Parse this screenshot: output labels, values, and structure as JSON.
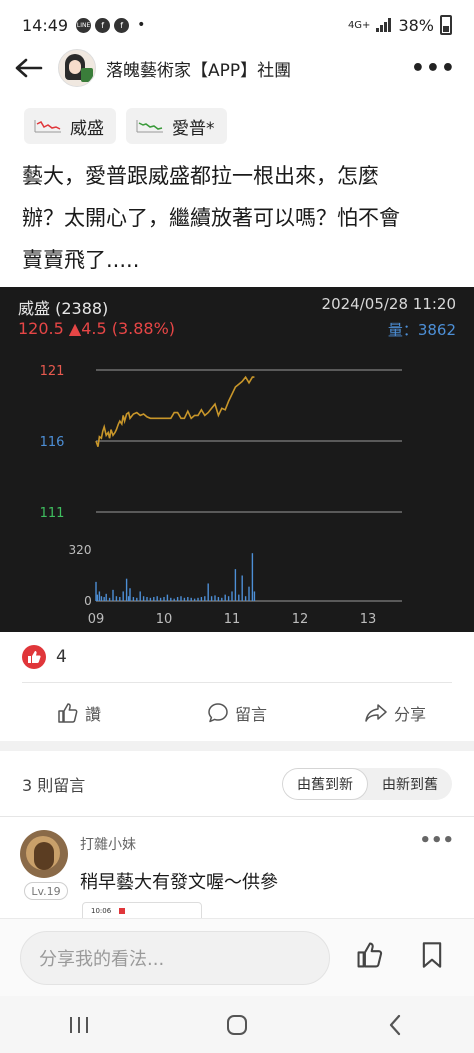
{
  "status_bar": {
    "time": "14:49",
    "apps": [
      "LINE",
      "f",
      "f"
    ],
    "dot": "•",
    "network": "4G+",
    "battery": "38%"
  },
  "header": {
    "back_icon": "arrow-left-icon",
    "group_name": "落魄藝術家【APP】社團",
    "more_label": "•••"
  },
  "tags": [
    {
      "label": "威盛"
    },
    {
      "label": "愛普*"
    }
  ],
  "post": {
    "lines": [
      "藝大，愛普跟威盛都拉一根出來，怎麼",
      "辦？太開心了，繼續放著可以嗎？怕不會",
      "賣賣飛了....."
    ]
  },
  "chart_data": {
    "type": "line",
    "stock_name": "威盛 (2388)",
    "price_text": "120.5 ▲4.5 (3.88%)",
    "datetime": "2024/05/28 11:20",
    "volume_text": "量：3862",
    "price_ticks": [
      {
        "label": "121",
        "value": 121,
        "color": "#e85a4f"
      },
      {
        "label": "116",
        "value": 116,
        "color": "#4d8fd6"
      },
      {
        "label": "111",
        "value": 111,
        "color": "#3fbf5f"
      }
    ],
    "volume_tick": {
      "label": "320",
      "value": 320
    },
    "volume_zero": "0",
    "x_ticks": [
      "09",
      "10",
      "11",
      "12",
      "13"
    ],
    "x_tick_hours": [
      9,
      10,
      11,
      12,
      13
    ],
    "ylim": [
      111,
      121
    ],
    "volume_max": 320,
    "price_series": {
      "name": "",
      "color": "#c8962a",
      "times": [
        9.0,
        9.03,
        9.05,
        9.08,
        9.1,
        9.12,
        9.15,
        9.18,
        9.2,
        9.22,
        9.25,
        9.28,
        9.3,
        9.33,
        9.35,
        9.38,
        9.4,
        9.42,
        9.45,
        9.48,
        9.5,
        9.55,
        9.6,
        9.65,
        9.7,
        9.75,
        9.8,
        9.85,
        9.9,
        9.95,
        10.0,
        10.05,
        10.1,
        10.15,
        10.2,
        10.25,
        10.3,
        10.35,
        10.4,
        10.45,
        10.5,
        10.55,
        10.6,
        10.65,
        10.7,
        10.75,
        10.8,
        10.85,
        10.9,
        10.95,
        11.0,
        11.05,
        11.1,
        11.15,
        11.2,
        11.25,
        11.3,
        11.33
      ],
      "prices": [
        116.0,
        115.6,
        116.3,
        116.2,
        116.7,
        117.0,
        116.4,
        116.6,
        116.2,
        116.8,
        116.4,
        116.6,
        116.8,
        117.2,
        117.4,
        117.2,
        117.8,
        117.4,
        117.9,
        118.0,
        117.6,
        117.9,
        118.0,
        117.8,
        117.9,
        117.7,
        117.6,
        117.6,
        117.6,
        117.6,
        117.6,
        117.6,
        117.6,
        118.0,
        118.0,
        117.6,
        117.6,
        118.1,
        117.6,
        117.8,
        117.8,
        118.2,
        117.8,
        118.0,
        118.3,
        118.6,
        117.8,
        118.3,
        118.2,
        118.8,
        119.3,
        119.8,
        120.0,
        120.2,
        120.5,
        120.1,
        120.5,
        120.5
      ]
    },
    "volume_series": {
      "color": "#4d8fd6",
      "times": [
        9.0,
        9.02,
        9.05,
        9.08,
        9.12,
        9.15,
        9.2,
        9.25,
        9.3,
        9.35,
        9.4,
        9.45,
        9.48,
        9.5,
        9.55,
        9.6,
        9.65,
        9.7,
        9.75,
        9.8,
        9.85,
        9.9,
        9.95,
        10.0,
        10.05,
        10.1,
        10.15,
        10.2,
        10.25,
        10.3,
        10.35,
        10.4,
        10.45,
        10.5,
        10.55,
        10.6,
        10.65,
        10.7,
        10.75,
        10.8,
        10.85,
        10.9,
        10.95,
        11.0,
        11.05,
        11.1,
        11.15,
        11.2,
        11.25,
        11.3,
        11.33
      ],
      "volumes": [
        120,
        40,
        60,
        30,
        25,
        45,
        20,
        70,
        30,
        25,
        60,
        140,
        30,
        80,
        25,
        20,
        60,
        30,
        25,
        20,
        25,
        30,
        20,
        25,
        40,
        20,
        15,
        25,
        30,
        20,
        25,
        20,
        15,
        20,
        25,
        30,
        110,
        30,
        35,
        25,
        20,
        40,
        30,
        60,
        200,
        40,
        160,
        30,
        90,
        300,
        60
      ]
    }
  },
  "reactions": {
    "count": "4",
    "icon": "thumbs-up-icon"
  },
  "actions": {
    "like": "讚",
    "comment": "留言",
    "share": "分享"
  },
  "comments": {
    "count_label": "3 則留言",
    "sort_old_new": "由舊到新",
    "sort_new_old": "由新到舊",
    "first": {
      "author": "打雜小妹",
      "level": "Lv.19",
      "text": "稍早藝大有發文喔～供參",
      "thumb_time": "10:06",
      "more": "•••"
    }
  },
  "composer": {
    "placeholder": "分享我的看法..."
  },
  "nav": {
    "recent_icon": "recent-apps-icon",
    "home_icon": "home-icon",
    "back_icon": "nav-back-icon"
  }
}
